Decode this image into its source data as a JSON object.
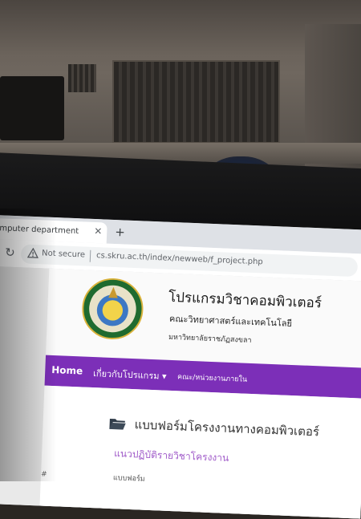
{
  "browser": {
    "tab_title": "mputer department",
    "tab_close_icon": "close-icon",
    "new_tab_icon": "plus-icon",
    "reload_icon": "reload-icon",
    "security_label": "Not secure",
    "url": "cs.skru.ac.th/index/newweb/f_project.php"
  },
  "site": {
    "title": "โปรแกรมวิชาคอมพิวเตอร์",
    "faculty": "คณะวิทยาศาสตร์และเทคโนโลยี",
    "university": "มหาวิทยาลัยราชภัฏสงขลา",
    "logo_icon": "university-seal-logo"
  },
  "nav": {
    "home": "Home",
    "about": "เกี่ยวกับโปรแกรม ▾",
    "faculty_units": "คณะ/หน่วยงานภายใน",
    "color": "#7c2fb8"
  },
  "content": {
    "folder_icon": "folder-open-icon",
    "title": "แบบฟอร์มโครงงานทางคอมพิวเตอร์",
    "subtitle": "แนวปฏิบัติรายวิชาโครงงาน",
    "label": "แบบฟอร์ม",
    "row_marker": "#"
  }
}
